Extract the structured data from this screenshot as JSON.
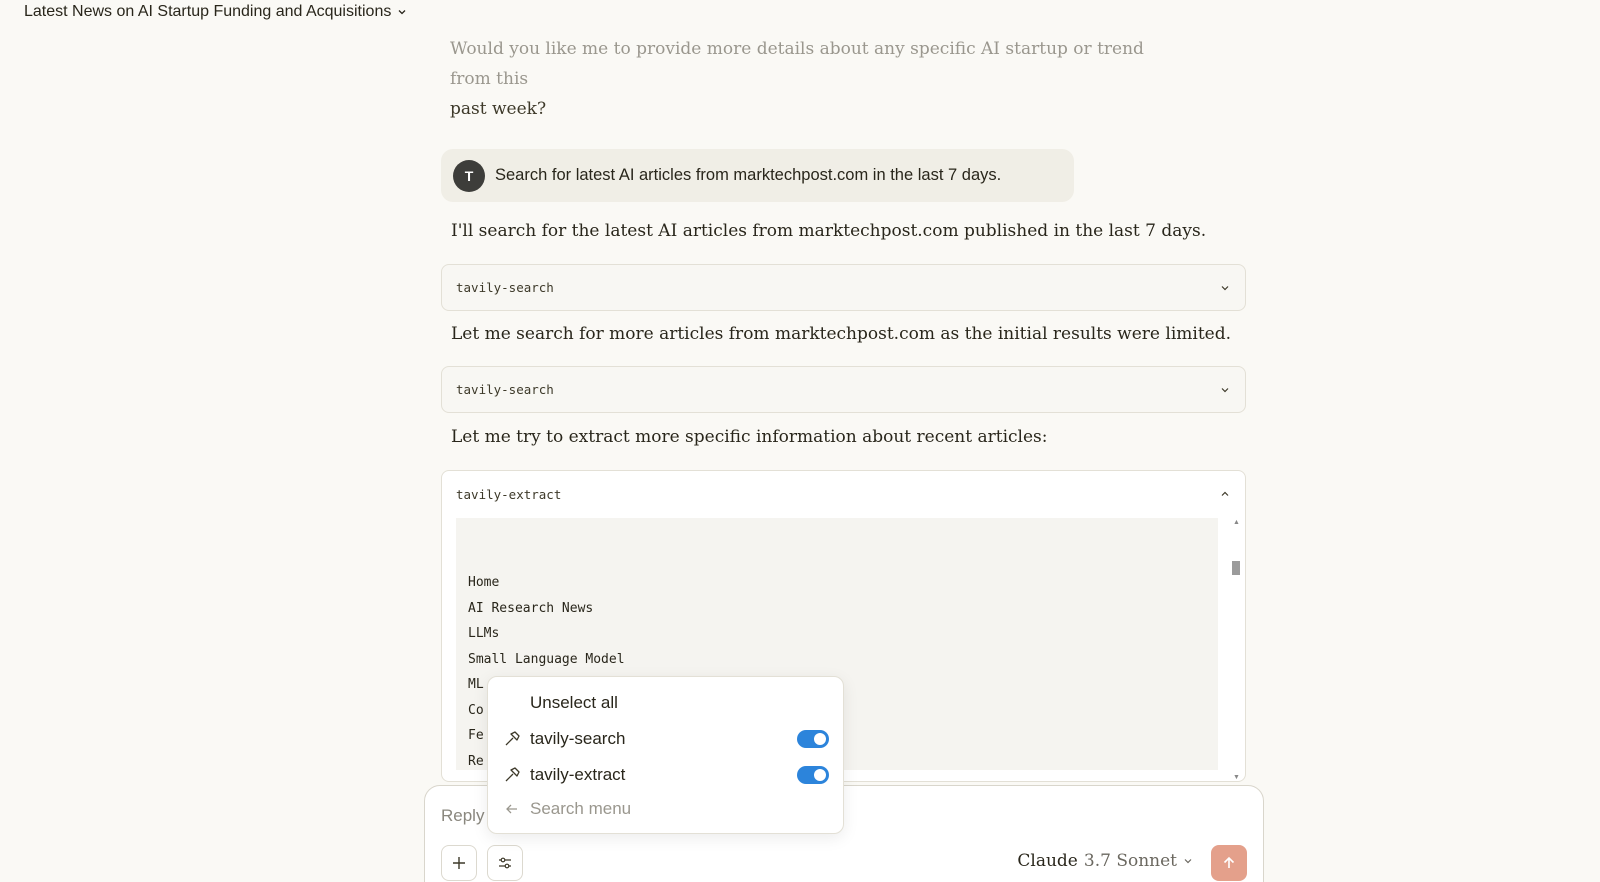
{
  "conversation": {
    "title": "Latest News on AI Startup Funding and Acquisitions"
  },
  "previous_message": {
    "line1": "Would you like me to provide more details about any specific AI startup or trend from this",
    "line2": "past week?"
  },
  "user_message": {
    "avatar_initial": "T",
    "text": "Search for latest AI articles from marktechpost.com in the last 7 days."
  },
  "assistant": {
    "line1": "I'll search for the latest AI articles from marktechpost.com published in the last 7 days.",
    "tool1": "tavily-search",
    "line2": "Let me search for more articles from marktechpost.com as the initial results were limited.",
    "tool2": "tavily-search",
    "line3": "Let me try to extract more specific information about recent articles:",
    "tool3": {
      "name": "tavily-extract",
      "output_lines": [
        "Home",
        "AI Research News",
        "LLMs",
        "Small Language Model",
        "ML",
        "Co",
        "Fe",
        "Re"
      ]
    }
  },
  "composer": {
    "placeholder": "Reply",
    "model_brand": "Claude",
    "model_version": "3.7 Sonnet"
  },
  "tools_menu": {
    "unselect_all": "Unselect all",
    "tools": [
      {
        "name": "tavily-search",
        "enabled": true
      },
      {
        "name": "tavily-extract",
        "enabled": true
      }
    ],
    "search_placeholder": "Search menu"
  },
  "colors": {
    "background": "#faf9f5",
    "toggle_on": "#2c84db",
    "send_button": "#e4a08b"
  }
}
